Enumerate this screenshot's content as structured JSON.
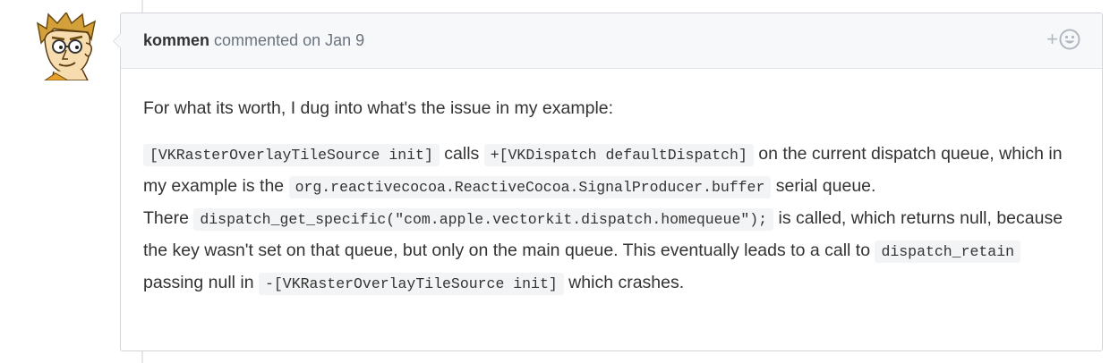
{
  "comment": {
    "author": "kommen",
    "action": "commented on",
    "date": "Jan 9",
    "reaction_plus": "+",
    "body": {
      "intro": "For what its worth, I dug into what's the issue in my example:",
      "line1": {
        "code1": "[VKRasterOverlayTileSource init]",
        "text1": " calls ",
        "code2": "+[VKDispatch defaultDispatch]",
        "text2": " on the current dispatch queue, which in my example is the ",
        "code3": "org.reactivecocoa.ReactiveCocoa.SignalProducer.buffer",
        "text3": " serial queue."
      },
      "line2": {
        "text1": "There ",
        "code1": "dispatch_get_specific(\"com.apple.vectorkit.dispatch.homequeue\");",
        "text2": " is called, which returns null, because the key wasn't set on that queue, but only on the main queue. This eventually leads to a call to ",
        "code2": "dispatch_retain",
        "text3": " passing null in ",
        "code3": "-[VKRasterOverlayTileSource init]",
        "text4": " which crashes."
      }
    }
  },
  "icons": {
    "avatar": "cartoon-avatar",
    "reaction": "smiley-icon"
  },
  "colors": {
    "header_bg": "#f6f8fa",
    "border": "#d1d5da",
    "code_bg": "#f3f4f5",
    "muted_text": "#6a737d"
  }
}
